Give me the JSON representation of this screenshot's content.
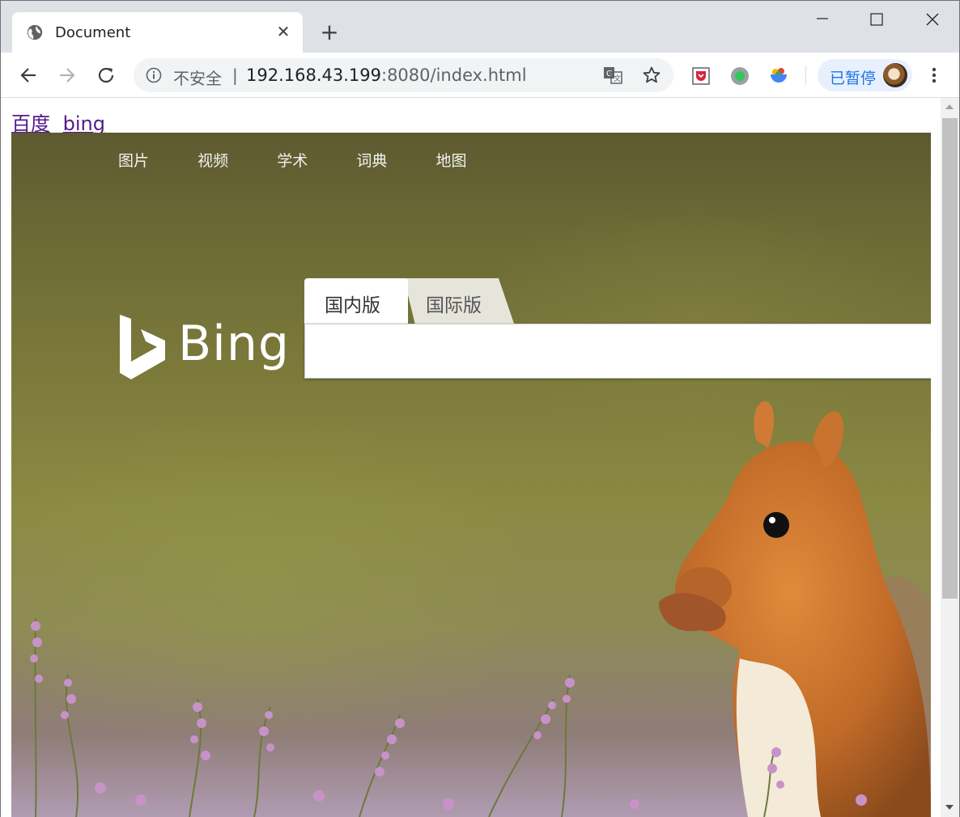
{
  "browser": {
    "tab_title": "Document",
    "new_tab_symbol": "+",
    "close_symbol": "✕",
    "security_label": "不安全",
    "separator": "|",
    "url_host": "192.168.43.199",
    "url_rest": ":8080/index.html",
    "profile_status": "已暂停",
    "icons": {
      "tab": "globe-icon",
      "back": "back-arrow-icon",
      "forward": "forward-arrow-icon",
      "reload": "reload-icon",
      "info": "info-icon",
      "translate": "translate-icon",
      "bookmark": "star-icon",
      "menu": "more-vert-icon"
    }
  },
  "page": {
    "links": [
      {
        "label": "百度"
      },
      {
        "label": "bing"
      }
    ]
  },
  "bing": {
    "nav": [
      "图片",
      "视频",
      "学术",
      "词典",
      "地图"
    ],
    "logo_text": "Bing",
    "tabs": [
      "国内版",
      "国际版"
    ],
    "search_value": ""
  },
  "colors": {
    "link_visited": "#551a8b",
    "paused_text": "#1a73e8",
    "paused_bg": "#e8f0fe"
  }
}
